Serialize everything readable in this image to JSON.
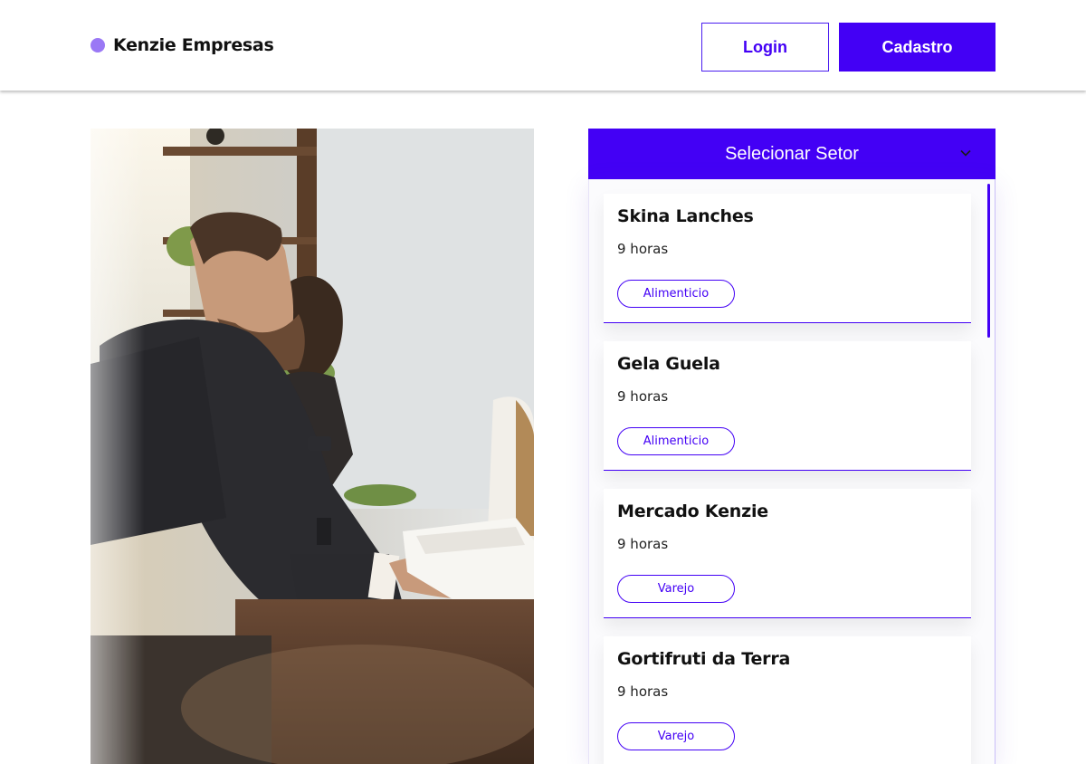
{
  "header": {
    "brand_name": "Kenzie Empresas",
    "login_label": "Login",
    "signup_label": "Cadastro"
  },
  "sector_select": {
    "label": "Selecionar Setor"
  },
  "companies": [
    {
      "name": "Skina Lanches",
      "time": "9 horas",
      "sector": "Alimenticio"
    },
    {
      "name": "Gela Guela",
      "time": "9 horas",
      "sector": "Alimenticio"
    },
    {
      "name": "Mercado Kenzie",
      "time": "9 horas",
      "sector": "Varejo"
    },
    {
      "name": "Gortifruti da Terra",
      "time": "9 horas",
      "sector": "Varejo"
    }
  ],
  "colors": {
    "primary": "#4300F5",
    "brand_dot": "#9A78F5"
  },
  "icons": {
    "select_toggle": "chevron-down-icon",
    "brand": "brand-dot-icon"
  }
}
